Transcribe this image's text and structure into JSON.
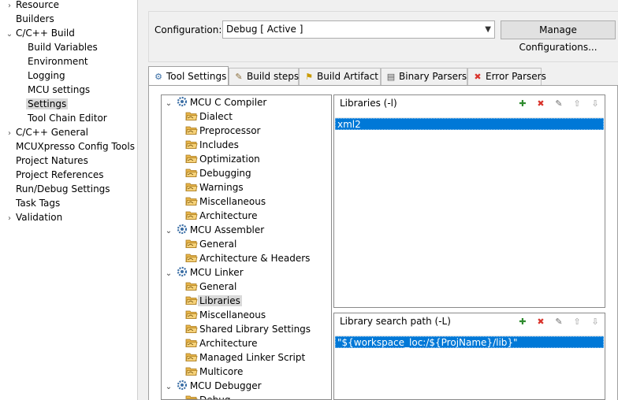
{
  "left_nav": {
    "items": [
      {
        "label": "Resource",
        "level": 1,
        "expander": "collapsed"
      },
      {
        "label": "Builders",
        "level": 1,
        "expander": ""
      },
      {
        "label": "C/C++ Build",
        "level": 1,
        "expander": "expanded"
      },
      {
        "label": "Build Variables",
        "level": 2,
        "expander": ""
      },
      {
        "label": "Environment",
        "level": 2,
        "expander": ""
      },
      {
        "label": "Logging",
        "level": 2,
        "expander": ""
      },
      {
        "label": "MCU settings",
        "level": 2,
        "expander": ""
      },
      {
        "label": "Settings",
        "level": 2,
        "expander": "",
        "selected": true
      },
      {
        "label": "Tool Chain Editor",
        "level": 2,
        "expander": ""
      },
      {
        "label": "C/C++ General",
        "level": 1,
        "expander": "collapsed"
      },
      {
        "label": "MCUXpresso Config Tools",
        "level": 1,
        "expander": ""
      },
      {
        "label": "Project Natures",
        "level": 1,
        "expander": ""
      },
      {
        "label": "Project References",
        "level": 1,
        "expander": ""
      },
      {
        "label": "Run/Debug Settings",
        "level": 1,
        "expander": ""
      },
      {
        "label": "Task Tags",
        "level": 1,
        "expander": ""
      },
      {
        "label": "Validation",
        "level": 1,
        "expander": "collapsed"
      }
    ]
  },
  "configuration": {
    "label": "Configuration:",
    "value": "Debug  [ Active ]",
    "manage_button": "Manage Configurations..."
  },
  "tabs": [
    {
      "label": "Tool Settings",
      "icon": "tool-settings-icon",
      "active": true
    },
    {
      "label": "Build steps",
      "icon": "build-steps-icon",
      "active": false
    },
    {
      "label": "Build Artifact",
      "icon": "build-artifact-icon",
      "active": false
    },
    {
      "label": "Binary Parsers",
      "icon": "binary-parsers-icon",
      "active": false
    },
    {
      "label": "Error Parsers",
      "icon": "error-parsers-icon",
      "active": false
    }
  ],
  "settings_tree": {
    "nodes": [
      {
        "label": "MCU C Compiler",
        "type": "tool",
        "expanded": true
      },
      {
        "label": "Dialect",
        "type": "option"
      },
      {
        "label": "Preprocessor",
        "type": "option"
      },
      {
        "label": "Includes",
        "type": "option"
      },
      {
        "label": "Optimization",
        "type": "option"
      },
      {
        "label": "Debugging",
        "type": "option"
      },
      {
        "label": "Warnings",
        "type": "option"
      },
      {
        "label": "Miscellaneous",
        "type": "option"
      },
      {
        "label": "Architecture",
        "type": "option"
      },
      {
        "label": "MCU Assembler",
        "type": "tool",
        "expanded": true
      },
      {
        "label": "General",
        "type": "option"
      },
      {
        "label": "Architecture & Headers",
        "type": "option"
      },
      {
        "label": "MCU Linker",
        "type": "tool",
        "expanded": true
      },
      {
        "label": "General",
        "type": "option"
      },
      {
        "label": "Libraries",
        "type": "option",
        "selected": true
      },
      {
        "label": "Miscellaneous",
        "type": "option"
      },
      {
        "label": "Shared Library Settings",
        "type": "option"
      },
      {
        "label": "Architecture",
        "type": "option"
      },
      {
        "label": "Managed Linker Script",
        "type": "option"
      },
      {
        "label": "Multicore",
        "type": "option"
      },
      {
        "label": "MCU Debugger",
        "type": "tool",
        "expanded": true
      },
      {
        "label": "Debug",
        "type": "option"
      }
    ]
  },
  "libraries_panel": {
    "title": "Libraries (-l)",
    "items": [
      "xml2"
    ]
  },
  "search_path_panel": {
    "title": "Library search path (-L)",
    "items": [
      "\"${workspace_loc:/${ProjName}/lib}\""
    ]
  },
  "panel_tools": [
    "add-icon",
    "delete-icon",
    "edit-icon",
    "move-up-icon",
    "move-down-icon"
  ],
  "colors": {
    "selection": "#0078d7",
    "tree_selection": "#d9d9d9",
    "gear": "#3a6ea5",
    "folder": "#e8b54a"
  }
}
